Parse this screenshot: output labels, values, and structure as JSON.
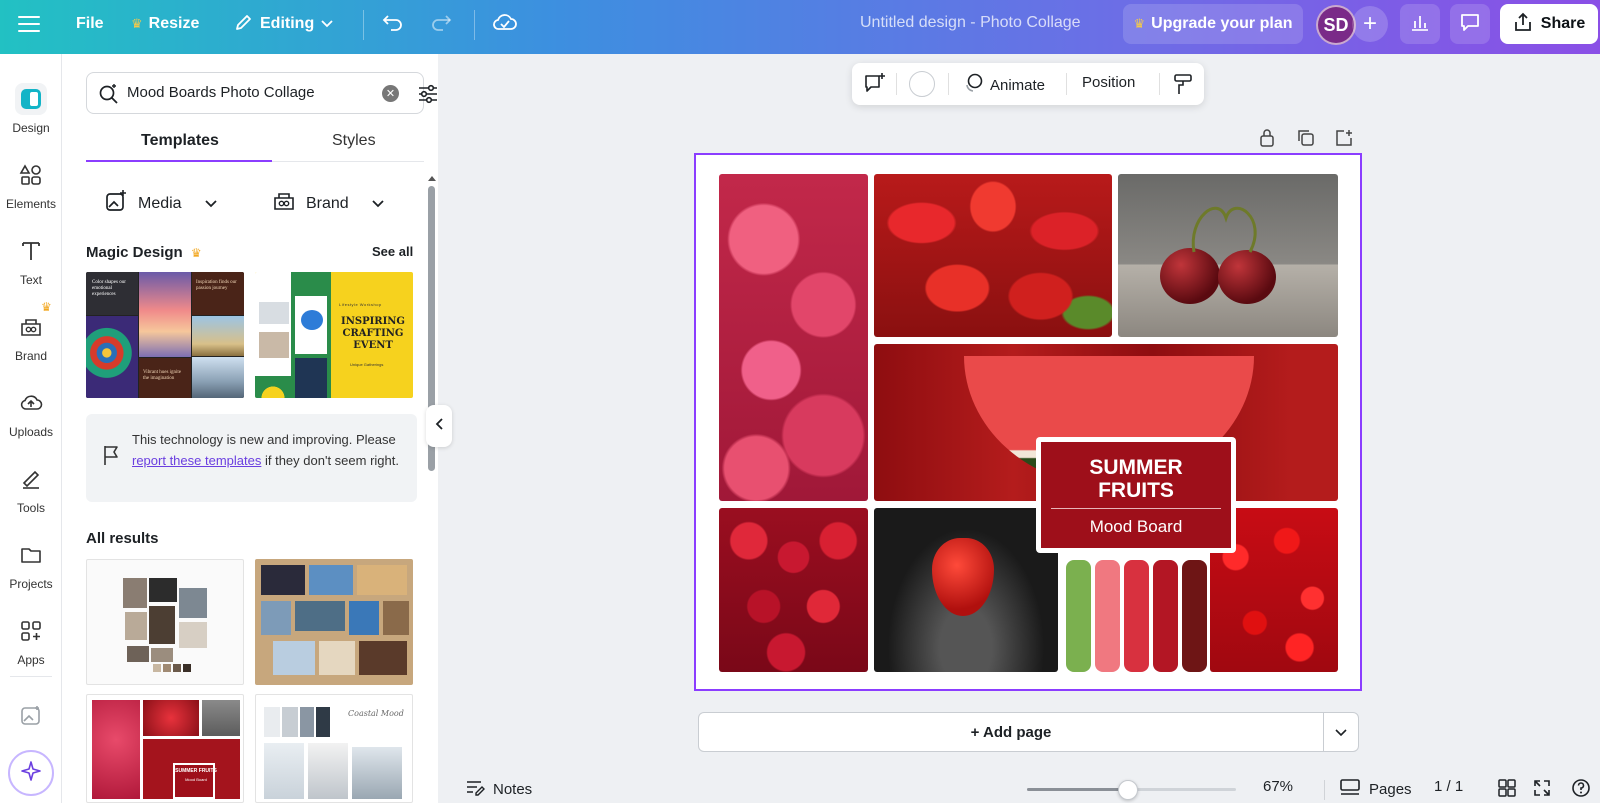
{
  "topbar": {
    "file": "File",
    "resize": "Resize",
    "editing": "Editing",
    "title": "Untitled design - Photo Collage",
    "upgrade": "Upgrade your plan",
    "avatar": "SD",
    "share": "Share",
    "crown_color": "#f2c94c"
  },
  "rail": {
    "items": [
      {
        "label": "Design",
        "icon": "design-icon"
      },
      {
        "label": "Elements",
        "icon": "elements-icon"
      },
      {
        "label": "Text",
        "icon": "text-icon"
      },
      {
        "label": "Brand",
        "icon": "brand-icon"
      },
      {
        "label": "Uploads",
        "icon": "uploads-icon"
      },
      {
        "label": "Tools",
        "icon": "tools-icon"
      },
      {
        "label": "Projects",
        "icon": "projects-icon"
      },
      {
        "label": "Apps",
        "icon": "apps-icon"
      }
    ]
  },
  "panel": {
    "search_value": "Mood Boards Photo Collage",
    "tabs": [
      "Templates",
      "Styles"
    ],
    "filters": {
      "media": "Media",
      "brand": "Brand"
    },
    "magic_design": "Magic Design",
    "see_all": "See all",
    "magic_items": [
      {
        "texts": [
          "Color shapes our emotional experiences",
          "Inspiration finds our passion journey",
          "Vibrant hues ignite the imagination"
        ]
      },
      {
        "caption": "Lifestyle Workshop",
        "title": "INSPIRING CRAFTING EVENT",
        "sub": "Unique Gatherings"
      }
    ],
    "notice_pre": "This technology is new and improving. Please ",
    "notice_link": "report these templates",
    "notice_post": " if they don't seem right.",
    "all_results": "All results",
    "result_thumb_title": "SUMMER FRUITS",
    "result_thumb_sub": "Mood Board",
    "result_thumb_script": "Coastal Mood"
  },
  "toolbar": {
    "animate": "Animate",
    "position": "Position"
  },
  "canvas": {
    "title": "SUMMER\nFRUITS",
    "title_line1": "SUMMER",
    "title_line2": "FRUITS",
    "subtitle": "Mood Board",
    "swatches": [
      "#7bb04f",
      "#f07880",
      "#d8313f",
      "#b31624",
      "#6e1515"
    ]
  },
  "add_page": "+ Add page",
  "bottom": {
    "notes": "Notes",
    "zoom": "67%",
    "zoom_level": 0.48,
    "pages": "Pages",
    "page_count": "1 / 1"
  }
}
